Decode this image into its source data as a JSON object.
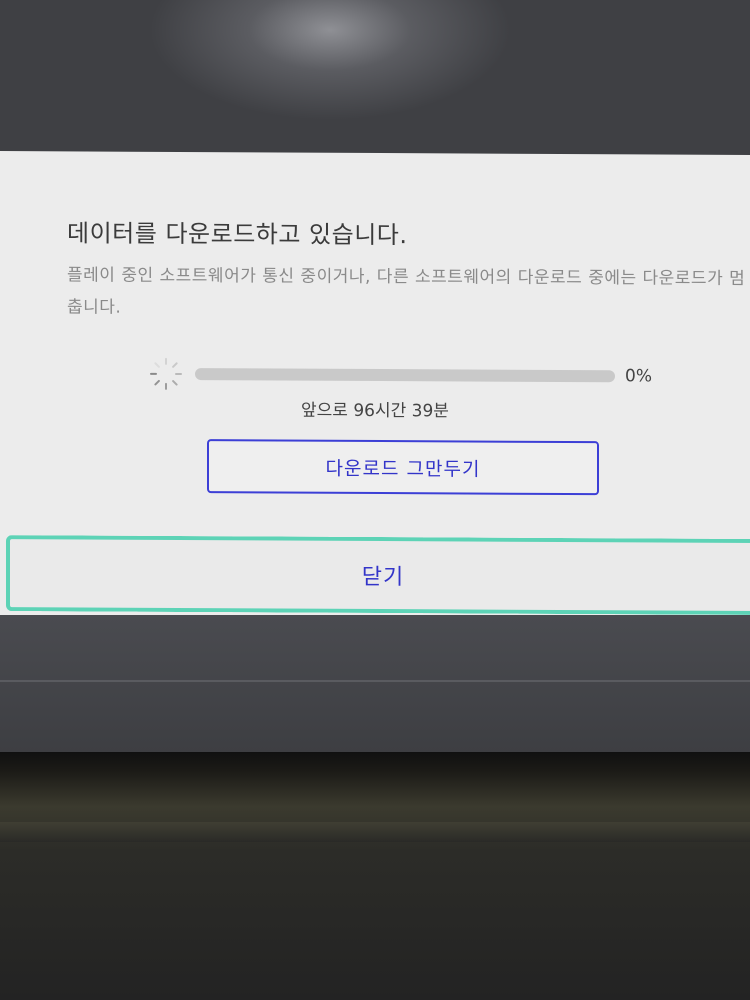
{
  "dialog": {
    "title": "데이터를 다운로드하고 있습니다.",
    "description": "플레이 중인 소프트웨어가 통신 중이거나, 다른 소프트웨어의 다운로드 중에는 다운로드가 멈춥니다.",
    "progress": {
      "percent_value": 0,
      "percent_label": "0%",
      "remaining": "앞으로 96시간 39분"
    },
    "cancel_label": "다운로드 그만두기",
    "close_label": "닫기",
    "colors": {
      "accent": "#3335c9",
      "focus": "#5dd3b6"
    },
    "icons": {
      "spinner": "loading-spinner-icon"
    }
  }
}
